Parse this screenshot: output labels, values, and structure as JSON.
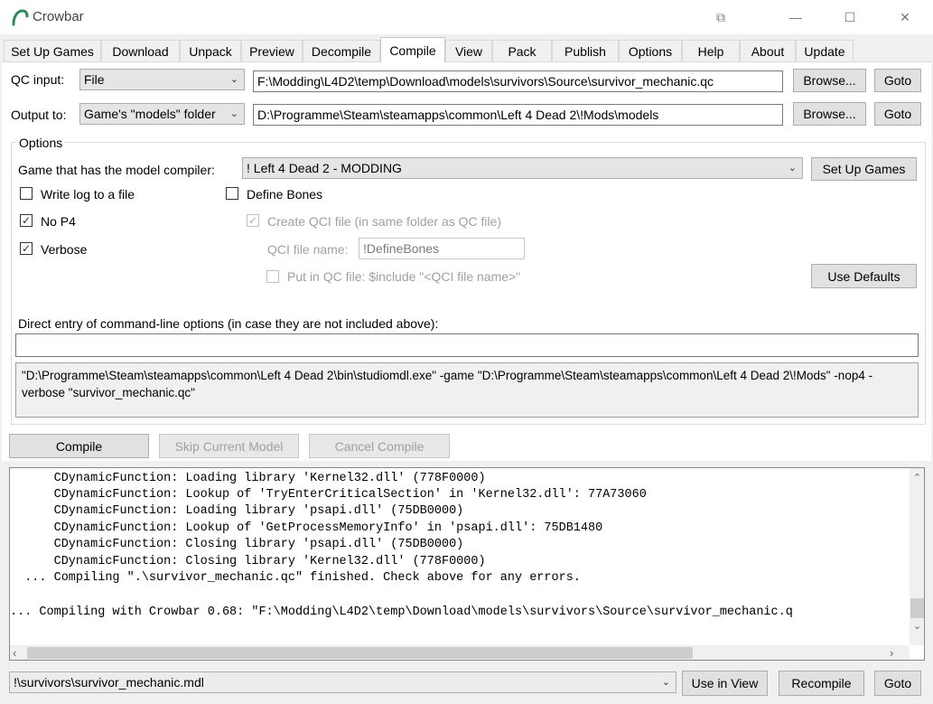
{
  "window": {
    "title": "Crowbar",
    "buttons": {
      "restore_glyph": "⧉",
      "minimize_glyph": "—",
      "maximize_glyph": "☐",
      "close_glyph": "✕"
    }
  },
  "tabs": [
    {
      "label": "Set Up Games"
    },
    {
      "label": "Download"
    },
    {
      "label": "Unpack"
    },
    {
      "label": "Preview"
    },
    {
      "label": "Decompile"
    },
    {
      "label": "Compile",
      "active": true
    },
    {
      "label": "View"
    },
    {
      "label": "Pack"
    },
    {
      "label": "Publish"
    },
    {
      "label": "Options"
    },
    {
      "label": "Help"
    },
    {
      "label": "About"
    },
    {
      "label": "Update"
    }
  ],
  "qc_input": {
    "label": "QC input:",
    "mode": "File",
    "path": "F:\\Modding\\L4D2\\temp\\Download\\models\\survivors\\Source\\survivor_mechanic.qc",
    "browse_label": "Browse...",
    "goto_label": "Goto"
  },
  "output_to": {
    "label": "Output to:",
    "mode": "Game's \"models\" folder",
    "path": "D:\\Programme\\Steam\\steamapps\\common\\Left 4 Dead 2\\!Mods\\models",
    "browse_label": "Browse...",
    "goto_label": "Goto"
  },
  "options": {
    "group_title": "Options",
    "game_label": "Game that has the model compiler:",
    "game_value": "! Left 4 Dead 2 - MODDING",
    "setup_games_label": "Set Up Games",
    "write_log": {
      "label": "Write log to a file",
      "checked": false
    },
    "no_p4": {
      "label": "No P4",
      "checked": true
    },
    "verbose": {
      "label": "Verbose",
      "checked": true
    },
    "define_bones": {
      "label": "Define Bones",
      "checked": false
    },
    "create_qci": {
      "label": "Create QCI file (in same folder as QC file)",
      "checked": true,
      "enabled": false
    },
    "qci_name_label": "QCI file name:",
    "qci_name_value": "!DefineBones",
    "put_in_qc": {
      "label": "Put in QC file: $include \"<QCI file name>\"",
      "checked": false,
      "enabled": false
    },
    "use_defaults_label": "Use Defaults",
    "direct_entry_label": "Direct entry of command-line options (in case they are not included above):",
    "direct_entry_value": "",
    "command_preview": "\"D:\\Programme\\Steam\\steamapps\\common\\Left 4 Dead 2\\bin\\studiomdl.exe\" -game \"D:\\Programme\\Steam\\steamapps\\common\\Left 4 Dead 2\\!Mods\" -nop4 -verbose \"survivor_mechanic.qc\""
  },
  "actions": {
    "compile_label": "Compile",
    "skip_label": "Skip Current Model",
    "cancel_label": "Cancel Compile"
  },
  "log_lines": [
    "      CDynamicFunction: Loading library 'Kernel32.dll' (778F0000)",
    "      CDynamicFunction: Lookup of 'TryEnterCriticalSection' in 'Kernel32.dll': 77A73060",
    "      CDynamicFunction: Loading library 'psapi.dll' (75DB0000)",
    "      CDynamicFunction: Lookup of 'GetProcessMemoryInfo' in 'psapi.dll': 75DB1480",
    "      CDynamicFunction: Closing library 'psapi.dll' (75DB0000)",
    "      CDynamicFunction: Closing library 'Kernel32.dll' (778F0000)",
    "  ... Compiling \".\\survivor_mechanic.qc\" finished. Check above for any errors.",
    "",
    "... Compiling with Crowbar 0.68: \"F:\\Modding\\L4D2\\temp\\Download\\models\\survivors\\Source\\survivor_mechanic.q"
  ],
  "bottom": {
    "output_file": "!\\survivors\\survivor_mechanic.mdl",
    "use_in_view_label": "Use in View",
    "recompile_label": "Recompile",
    "goto_label": "Goto"
  },
  "colors": {
    "logo": "#2e8b57",
    "tab_active": "#ffffff",
    "window_bg": "#f0f0f0"
  }
}
